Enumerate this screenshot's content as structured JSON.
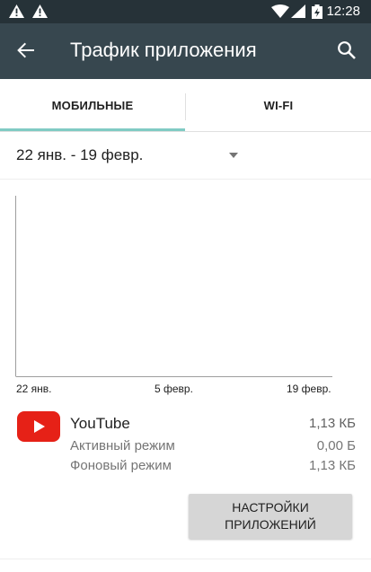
{
  "status_bar": {
    "time": "12:28",
    "icons": [
      "warning-icon",
      "warning-icon",
      "wifi-icon",
      "signal-icon",
      "battery-icon"
    ]
  },
  "app_bar": {
    "title": "Трафик приложения",
    "back_icon": "arrow-back-icon",
    "search_icon": "search-icon",
    "background": "#37474F"
  },
  "tabs": [
    {
      "label": "МОБИЛЬНЫЕ",
      "selected": true
    },
    {
      "label": "WI-FI",
      "selected": false
    }
  ],
  "accent_color": "#80CBC4",
  "date_range": {
    "label": "22 янв. - 19 февр."
  },
  "chart_data": {
    "type": "line",
    "x_tick_labels": [
      "22 янв.",
      "5 февр.",
      "19 февр."
    ],
    "series": [],
    "grid": false
  },
  "app_usage": {
    "name": "YouTube",
    "total": "1,13 КБ",
    "foreground_label": "Активный режим",
    "foreground_value": "0,00 Б",
    "background_label": "Фоновый режим",
    "background_value": "1,13 КБ",
    "icon": "youtube-icon"
  },
  "settings_button": {
    "line1": "НАСТРОЙКИ",
    "line2": "ПРИЛОЖЕНИЙ"
  }
}
